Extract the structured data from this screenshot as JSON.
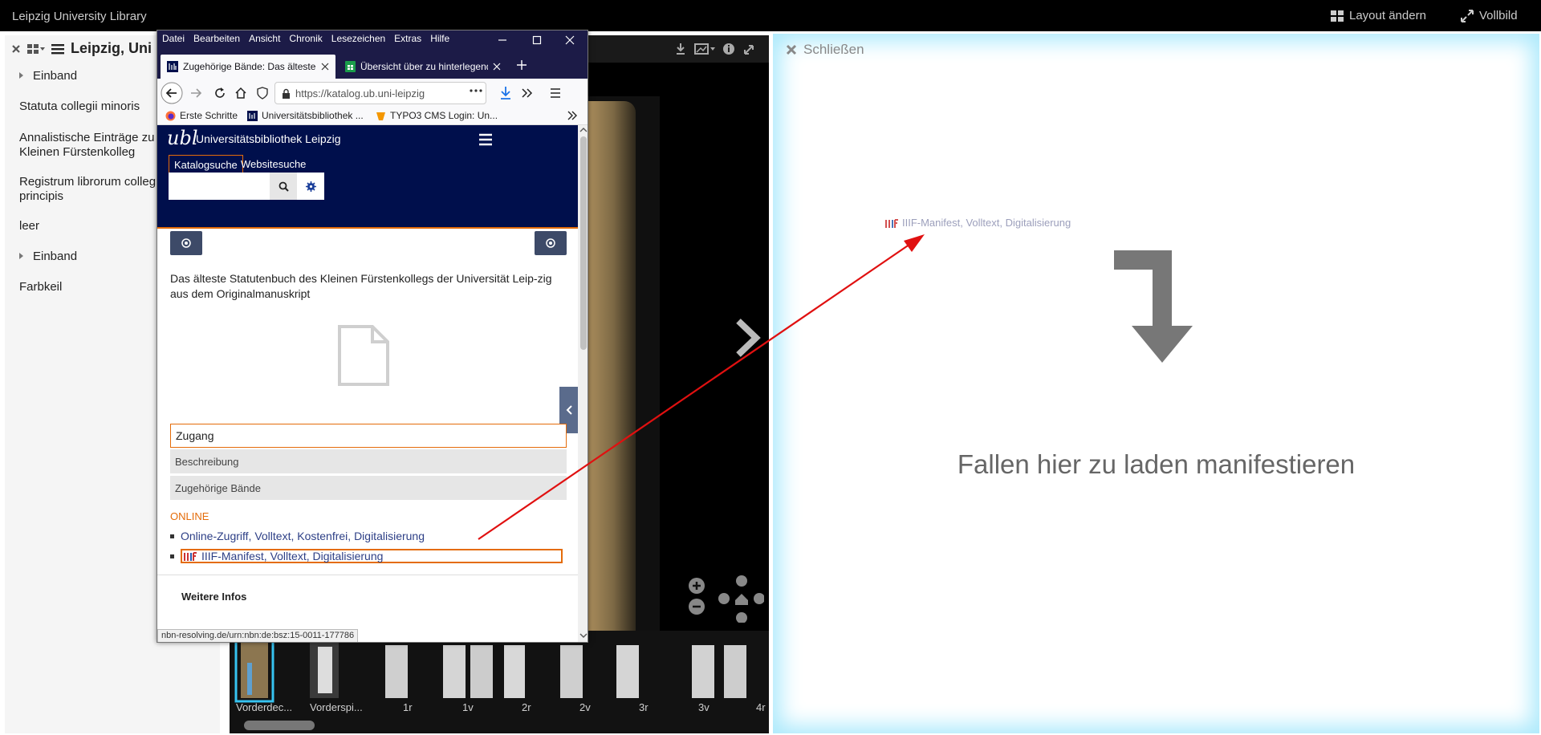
{
  "topbar": {
    "title": "Leipzig University Library",
    "layout_label": "Layout ändern",
    "fullscreen_label": "Vollbild"
  },
  "left_panel": {
    "title": "Leipzig, Uni",
    "items": [
      {
        "label": "Einband",
        "expandable": true
      },
      {
        "label": "Statuta collegii minoris",
        "expandable": false
      },
      {
        "label": "Annalistische Einträge zu Kleinen Fürstenkolleg",
        "expandable": false
      },
      {
        "label": "Registrum librorum collegii principis",
        "expandable": false
      },
      {
        "label": "leer",
        "expandable": false
      },
      {
        "label": "Einband",
        "expandable": true
      },
      {
        "label": "Farbkeil",
        "expandable": false
      }
    ]
  },
  "viewer": {
    "thumbnails": [
      "Vorderdec...",
      "Vorderspi...",
      "1r",
      "1v",
      "2r",
      "2v",
      "3r",
      "3v",
      "4r"
    ]
  },
  "right_panel": {
    "close_label": "Schließen",
    "drop_text": "Fallen hier zu laden manifestieren",
    "dragged_link": "IIIF-Manifest, Volltext, Digitalisierung"
  },
  "browser": {
    "menu": [
      "Datei",
      "Bearbeiten",
      "Ansicht",
      "Chronik",
      "Lesezeichen",
      "Extras",
      "Hilfe"
    ],
    "tabs": [
      {
        "label": "Zugehörige Bände: Das älteste S",
        "active": true
      },
      {
        "label": "Übersicht über zu hinterlegende",
        "active": false
      }
    ],
    "url": "https://katalog.ub.uni-leipzig",
    "bookmarks": [
      "Erste Schritte",
      "Universitätsbibliothek ...",
      "TYPO3 CMS Login: Un..."
    ],
    "status_url": "nbn-resolving.de/urn:nbn:de:bsz:15-0011-177786"
  },
  "page": {
    "logo": "ubl",
    "site_title": "Universitätsbibliothek Leipzig",
    "search_tabs": [
      "Katalogsuche",
      "Websitesuche"
    ],
    "search_placeholder": "",
    "description": "Das älteste Statutenbuch des Kleinen Fürstenkollegs der Universität Leip-zig aus dem Originalmanuskript",
    "accordion": [
      "Zugang",
      "Beschreibung",
      "Zugehörige Bände"
    ],
    "online_heading": "ONLINE",
    "links": [
      "Online-Zugriff, Volltext, Kostenfrei, Digitalisierung",
      "IIIF-Manifest, Volltext, Digitalisierung"
    ],
    "more_info": "Weitere Infos"
  },
  "colors": {
    "accent_orange": "#e46c0a",
    "header_navy": "#000f4c",
    "drop_glow": "#aeeafc",
    "arrow": "#e01010"
  }
}
